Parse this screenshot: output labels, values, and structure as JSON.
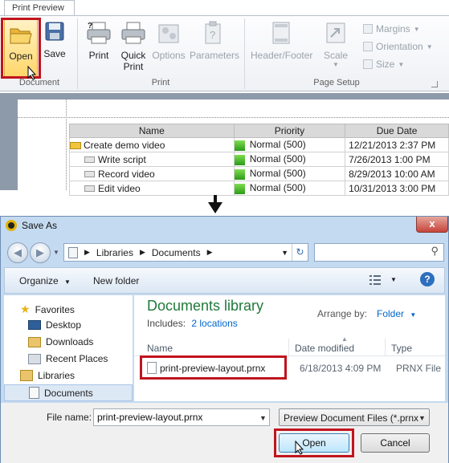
{
  "ribbon": {
    "tab_label": "Print Preview",
    "groups": {
      "document": "Document",
      "print": "Print",
      "page_setup": "Page Setup"
    },
    "buttons": {
      "open": "Open",
      "save": "Save",
      "print": "Print",
      "quick_print_1": "Quick",
      "quick_print_2": "Print",
      "options": "Options",
      "parameters": "Parameters",
      "header_footer": "Header/Footer",
      "scale": "Scale",
      "margins": "Margins",
      "orientation": "Orientation",
      "size": "Size"
    }
  },
  "report": {
    "headers": [
      "Name",
      "Priority",
      "Due Date"
    ],
    "rows": [
      {
        "name": "Create demo video",
        "priority": "Normal (500)",
        "due": "12/21/2013 2:37 PM"
      },
      {
        "name": "Write script",
        "priority": "Normal (500)",
        "due": "7/26/2013 1:00 PM"
      },
      {
        "name": "Record video",
        "priority": "Normal (500)",
        "due": "8/29/2013 10:00 AM"
      },
      {
        "name": "Edit video",
        "priority": "Normal (500)",
        "due": "10/31/2013 3:00 PM"
      }
    ]
  },
  "dialog": {
    "title": "Save As",
    "close": "x",
    "address": {
      "parts": [
        "Libraries",
        "Documents"
      ]
    },
    "toolbar": {
      "organize": "Organize",
      "new_folder": "New folder"
    },
    "nav": {
      "favorites": "Favorites",
      "desktop": "Desktop",
      "downloads": "Downloads",
      "recent_places": "Recent Places",
      "libraries": "Libraries",
      "documents": "Documents"
    },
    "library": {
      "title": "Documents library",
      "includes_label": "Includes:",
      "includes_link": "2 locations",
      "arrange_label": "Arrange by:",
      "arrange_value": "Folder"
    },
    "columns": {
      "name": "Name",
      "date_modified": "Date modified",
      "type": "Type"
    },
    "file": {
      "name": "print-preview-layout.prnx",
      "date": "6/18/2013 4:09 PM",
      "type": "PRNX File"
    },
    "filename_label": "File name:",
    "filename_value": "print-preview-layout.prnx",
    "filter_value": "Preview Document Files (*.prnx",
    "open_button": "Open",
    "cancel_button": "Cancel"
  },
  "colors": {
    "highlight": "#c0141e",
    "library_title": "#1f7a3b",
    "link": "#0066cc"
  }
}
